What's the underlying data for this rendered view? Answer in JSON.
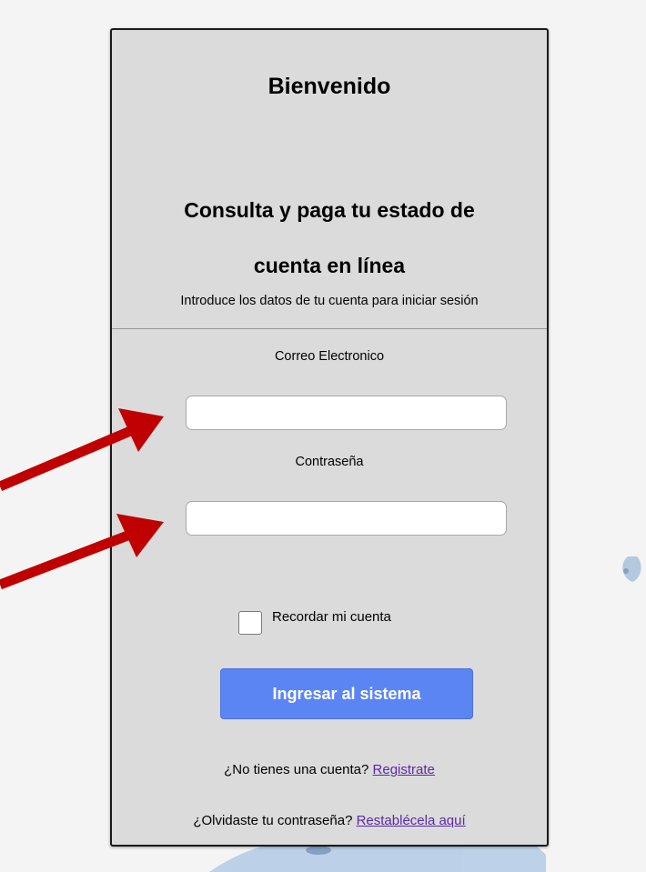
{
  "page": {
    "title": "Bienvenido",
    "subtitle_line1": "Consulta y paga tu estado de",
    "subtitle_line2": "cuenta en línea",
    "intro": "Introduce los datos de tu cuenta para iniciar sesión"
  },
  "form": {
    "email_label": "Correo Electronico",
    "email_value": "",
    "email_placeholder": "",
    "password_label": "Contraseña",
    "password_value": "",
    "password_placeholder": "",
    "remember_label": "Recordar mi cuenta",
    "remember_checked": false,
    "submit_label": "Ingresar al sistema"
  },
  "footer": {
    "register_prompt": "¿No tienes una cuenta? ",
    "register_link": "Registrate",
    "forgot_prompt": "¿Olvidaste tu contraseña? ",
    "forgot_link": "Restablécela aquí"
  },
  "annotations": {
    "arrow_color": "#c00000",
    "arrow_count": 2
  },
  "colors": {
    "card_bg": "#dbdbdb",
    "button_bg": "#5b85f2",
    "link": "#5a2aa6"
  }
}
